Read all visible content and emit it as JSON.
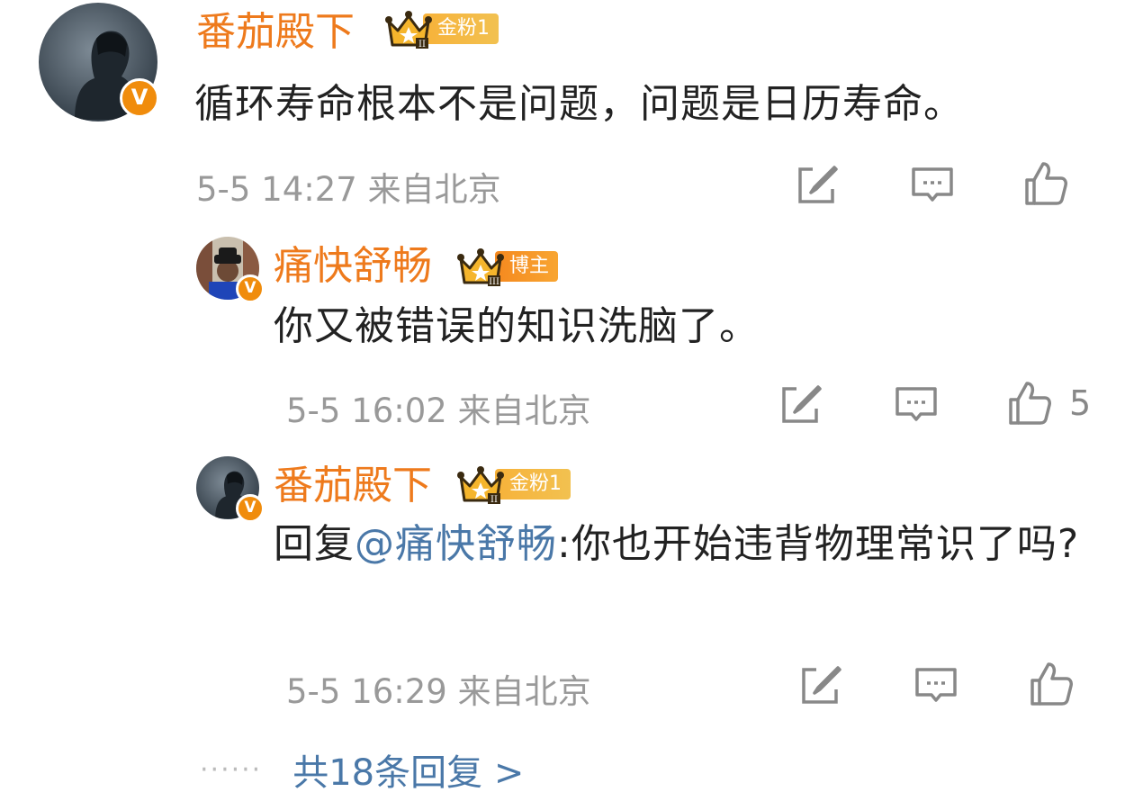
{
  "comment": {
    "user": "番茄殿下",
    "fan_badge": "金粉1",
    "text": "循环寿命根本不是问题，问题是日历寿命。",
    "time": "5-5 14:27",
    "location": "来自北京"
  },
  "replies": [
    {
      "user": "痛快舒畅",
      "fan_badge": "博主",
      "text": "你又被错误的知识洗脑了。",
      "time": "5-5 16:02",
      "location": "来自北京",
      "likes": "5"
    },
    {
      "user": "番茄殿下",
      "fan_badge": "金粉1",
      "reply_prefix": "回复",
      "mention": "@痛快舒畅",
      "text": ":你也开始违背物理常识了吗?",
      "time": "5-5 16:29",
      "location": "来自北京"
    }
  ],
  "more": {
    "dots": "······",
    "label": "共18条回复 >"
  },
  "icons": {
    "verified": "V",
    "share": "share-icon",
    "comment": "comment-icon",
    "like": "like-icon"
  },
  "colors": {
    "username": "#ee7a1c",
    "mention": "#4a78a8",
    "meta": "#999999",
    "verified": "#f08c0c"
  }
}
